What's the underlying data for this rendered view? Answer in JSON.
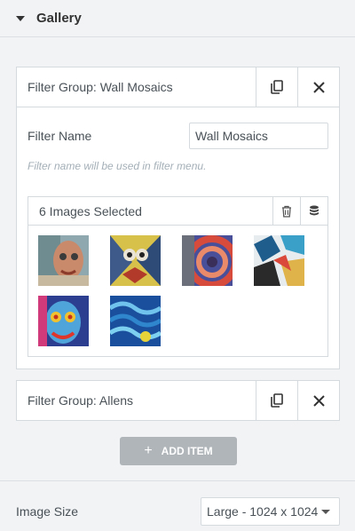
{
  "panel": {
    "title": "Gallery"
  },
  "filter_groups": [
    {
      "title": "Filter Group: Wall Mosaics",
      "filter_name_label": "Filter Name",
      "filter_name_value": "Wall Mosaics",
      "filter_name_desc": "Filter name will be used in filter menu.",
      "images_selected": "6 Images Selected",
      "thumbnails": [
        "graffiti-face",
        "graffiti-warriors",
        "graffiti-swirl",
        "graffiti-shapes",
        "graffiti-portrait",
        "graffiti-waves"
      ]
    },
    {
      "title": "Filter Group: Allens"
    }
  ],
  "add_item": {
    "label": "ADD ITEM",
    "icon": "plus-icon"
  },
  "image_size": {
    "label": "Image Size",
    "selected": "Large - 1024 x 1024"
  },
  "icons": {
    "collapse": "caret-down-icon",
    "duplicate": "copy-icon",
    "remove": "close-icon",
    "delete": "trash-icon",
    "library": "database-icon",
    "select": "chevron-down-icon"
  }
}
